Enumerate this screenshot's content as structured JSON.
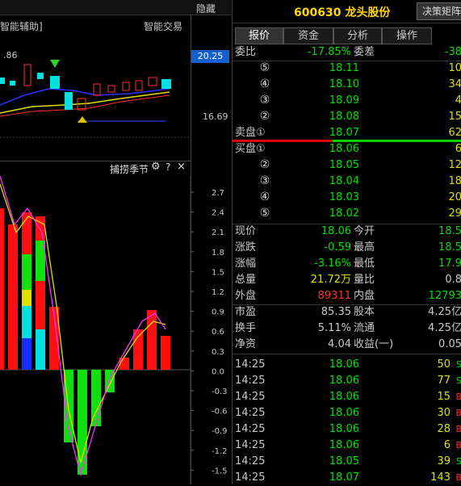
{
  "header": {
    "hide_label": "隐藏",
    "stock_title": "600630 龙头股份",
    "decision_button": "决策矩阵"
  },
  "left_top": {
    "assist_label": "智能辅助]",
    "smart_trade": "智能交易",
    "price_high_label": "20.25",
    "price_low_label": "16.69",
    "price_left_label": ".86"
  },
  "indicator": {
    "title": "捕捞季节",
    "gear_icon": "gear-icon",
    "help": "?",
    "close": "×",
    "axis_ticks": [
      "2.7",
      "2.4",
      "2.1",
      "1.8",
      "1.5",
      "1.2",
      "0.9",
      "0.6",
      "0.3",
      "0.0",
      "-0.3",
      "-0.6",
      "-0.9",
      "-1.2",
      "-1.5"
    ]
  },
  "tabs": [
    "报价",
    "资金",
    "分析",
    "操作"
  ],
  "weibi": {
    "label": "委比",
    "value": "-17.85%",
    "label2": "委差",
    "value2": "-38"
  },
  "sells": [
    {
      "level": "⑤",
      "price": "18.11",
      "vol": "10"
    },
    {
      "level": "④",
      "price": "18.10",
      "vol": "34"
    },
    {
      "level": "③",
      "price": "18.09",
      "vol": "4"
    },
    {
      "level": "②",
      "price": "18.08",
      "vol": "15"
    },
    {
      "level": "卖盘①",
      "price": "18.07",
      "vol": "62"
    }
  ],
  "buys": [
    {
      "level": "买盘①",
      "price": "18.06",
      "vol": "6"
    },
    {
      "level": "②",
      "price": "18.05",
      "vol": "12"
    },
    {
      "level": "③",
      "price": "18.04",
      "vol": "18"
    },
    {
      "level": "④",
      "price": "18.03",
      "vol": "20"
    },
    {
      "level": "⑤",
      "price": "18.02",
      "vol": "29"
    }
  ],
  "quote": [
    {
      "l1": "现价",
      "v1": "18.06",
      "l2": "今开",
      "v2": "18.5"
    },
    {
      "l1": "涨跌",
      "v1": "-0.59",
      "l2": "最高",
      "v2": "18.5"
    },
    {
      "l1": "涨幅",
      "v1": "-3.16%",
      "l2": "最低",
      "v2": "17.9"
    },
    {
      "l1": "总量",
      "v1": "21.72万",
      "l2": "量比",
      "v2": "0.8"
    },
    {
      "l1": "外盘",
      "v1": "89311",
      "l2": "内盘",
      "v2": "12793"
    }
  ],
  "fin": [
    {
      "l1": "市盈",
      "v1": "85.35",
      "l2": "股本",
      "v2": "4.25亿"
    },
    {
      "l1": "换手",
      "v1": "5.11%",
      "l2": "流通",
      "v2": "4.25亿"
    },
    {
      "l1": "净资",
      "v1": "4.04",
      "l2": "收益(一)",
      "v2": "0.05"
    }
  ],
  "ticks": [
    {
      "time": "14:25",
      "price": "18.06",
      "vol": "50",
      "dir": "S"
    },
    {
      "time": "14:25",
      "price": "18.06",
      "vol": "77",
      "dir": "S"
    },
    {
      "time": "14:25",
      "price": "18.06",
      "vol": "15",
      "dir": "B"
    },
    {
      "time": "14:25",
      "price": "18.06",
      "vol": "30",
      "dir": "B"
    },
    {
      "time": "14:25",
      "price": "18.06",
      "vol": "28",
      "dir": "B"
    },
    {
      "time": "14:25",
      "price": "18.06",
      "vol": "6",
      "dir": "B"
    },
    {
      "time": "14:25",
      "price": "18.05",
      "vol": "39",
      "dir": "S"
    },
    {
      "time": "14:25",
      "price": "18.07",
      "vol": "143",
      "dir": "B"
    }
  ],
  "colors": {
    "up": "#ff3030",
    "down": "#00e000",
    "vol": "#e0e000",
    "cyan": "#00e0e0"
  }
}
